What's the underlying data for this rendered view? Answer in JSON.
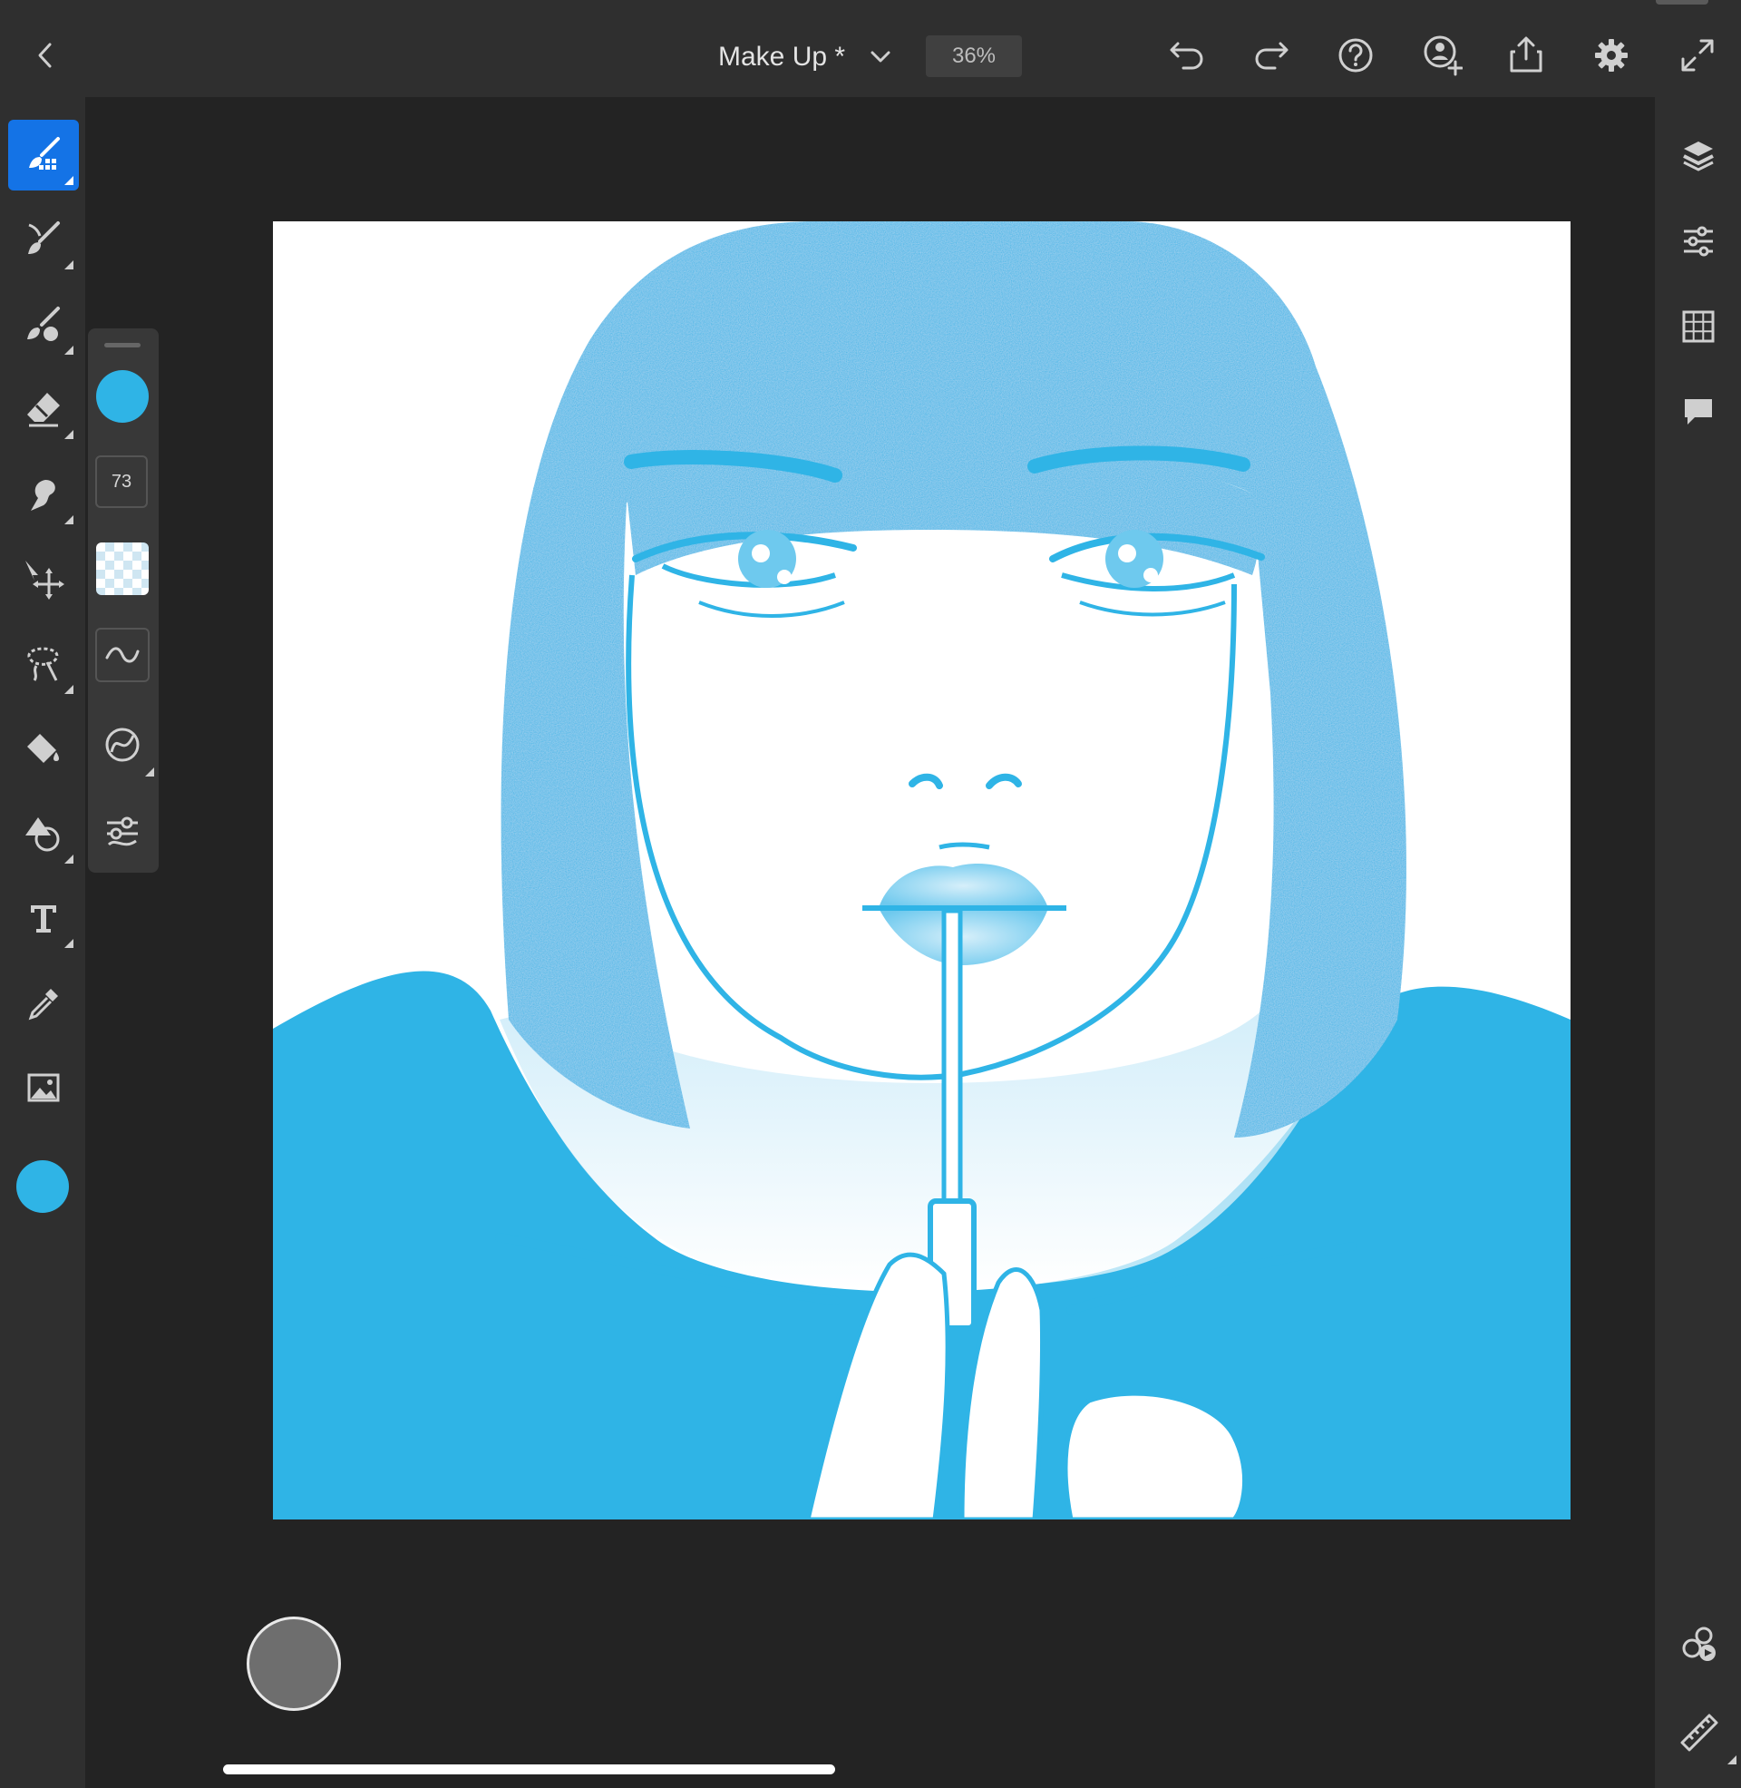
{
  "document": {
    "title": "Make Up *",
    "zoom": "36%"
  },
  "toolbar": {
    "brush_size": "73"
  },
  "colors": {
    "accent": "#1473e6",
    "brush_color": "#2fb4e6",
    "panel_bg": "#2f2f2f",
    "canvas_bg": "#ffffff"
  }
}
